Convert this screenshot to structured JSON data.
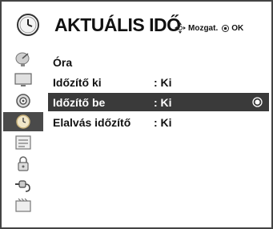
{
  "header": {
    "title": "AKTUÁLIS IDŐ",
    "move_hint": "Mozgat.",
    "ok_hint": "OK"
  },
  "sidebar": {
    "items": [
      {
        "icon": "satellite-dish-icon"
      },
      {
        "icon": "monitor-icon"
      },
      {
        "icon": "speaker-icon"
      },
      {
        "icon": "clock-icon",
        "active": true
      },
      {
        "icon": "options-icon"
      },
      {
        "icon": "lock-icon"
      },
      {
        "icon": "input-plug-icon"
      },
      {
        "icon": "usb-media-icon"
      }
    ]
  },
  "menu": {
    "items": [
      {
        "label": "Óra",
        "value": ""
      },
      {
        "label": "Időzítő ki",
        "value": ": Ki"
      },
      {
        "label": "Időzítő be",
        "value": ": Ki",
        "selected": true
      },
      {
        "label": "Elalvás időzítő",
        "value": ": Ki"
      }
    ]
  },
  "colors": {
    "selected_row": "#3a3a3a",
    "active_sidebar": "#4a4a4a",
    "text": "#111111",
    "selected_text": "#ffffff"
  }
}
